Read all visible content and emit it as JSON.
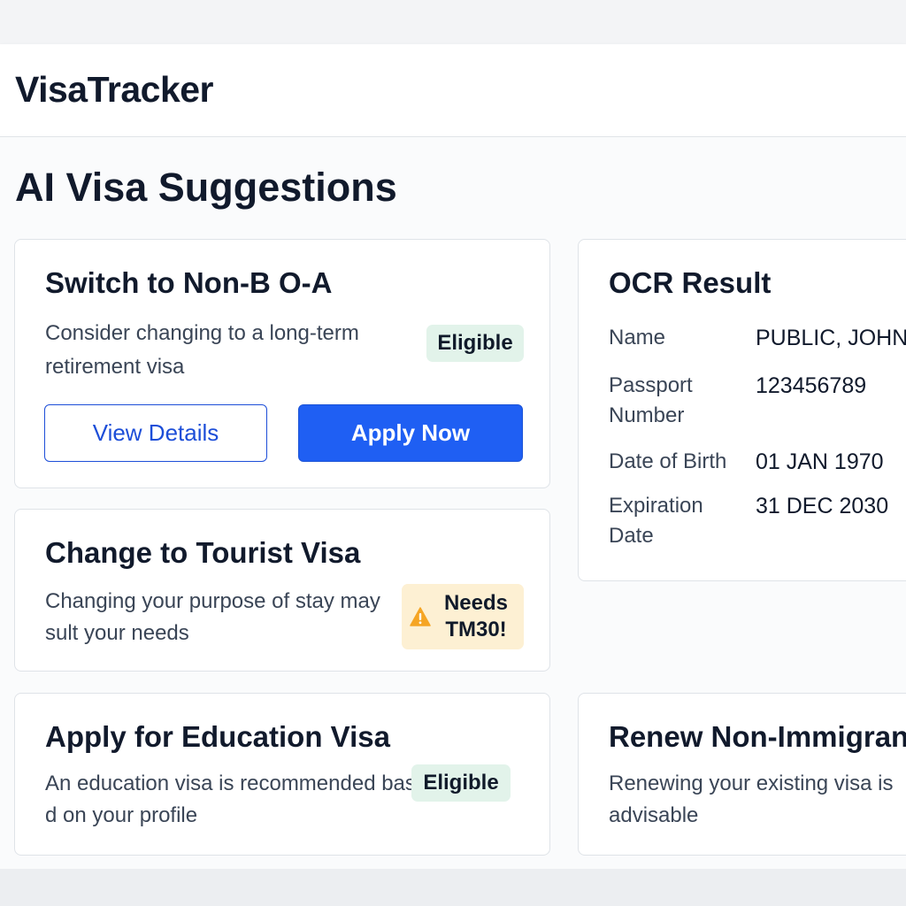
{
  "app": {
    "title": "VisaTracker"
  },
  "page": {
    "title": "AI Visa Suggestions"
  },
  "suggestions": [
    {
      "title": "Switch to Non-B O-A",
      "description": "Consider changing to a long-term retirement visa",
      "badge": "Eligible",
      "badge_status": "eligible",
      "actions": {
        "view_details": "View Details",
        "apply_now": "Apply Now"
      }
    },
    {
      "title": "Change to Tourist Visa",
      "description": "Changing your purpose of stay may sult your needs",
      "badge": "Needs TM30!",
      "badge_status": "warning",
      "badge_icon": "warning-icon"
    },
    {
      "title": "Apply for Education Visa",
      "description": "An education visa is recommended base d on your profile",
      "badge": "Eligible",
      "badge_status": "eligible"
    },
    {
      "title": "Renew Non-Immigrant",
      "description": "Renewing your existing visa is advisable"
    }
  ],
  "ocr": {
    "title": "OCR Result",
    "fields": [
      {
        "label": "Name",
        "value": "PUBLIC, JOHN"
      },
      {
        "label": "Passport Number",
        "value": "123456789"
      },
      {
        "label": "Date of Birth",
        "value": "01 JAN 1970"
      },
      {
        "label": "Expiration Date",
        "value": "31 DEC 2030"
      }
    ]
  },
  "colors": {
    "primary": "#1f5ff3",
    "eligible_bg": "#e2f3ea",
    "warning_bg": "#fdf0d3",
    "warning_icon": "#f5a524",
    "text": "#111a2c"
  }
}
